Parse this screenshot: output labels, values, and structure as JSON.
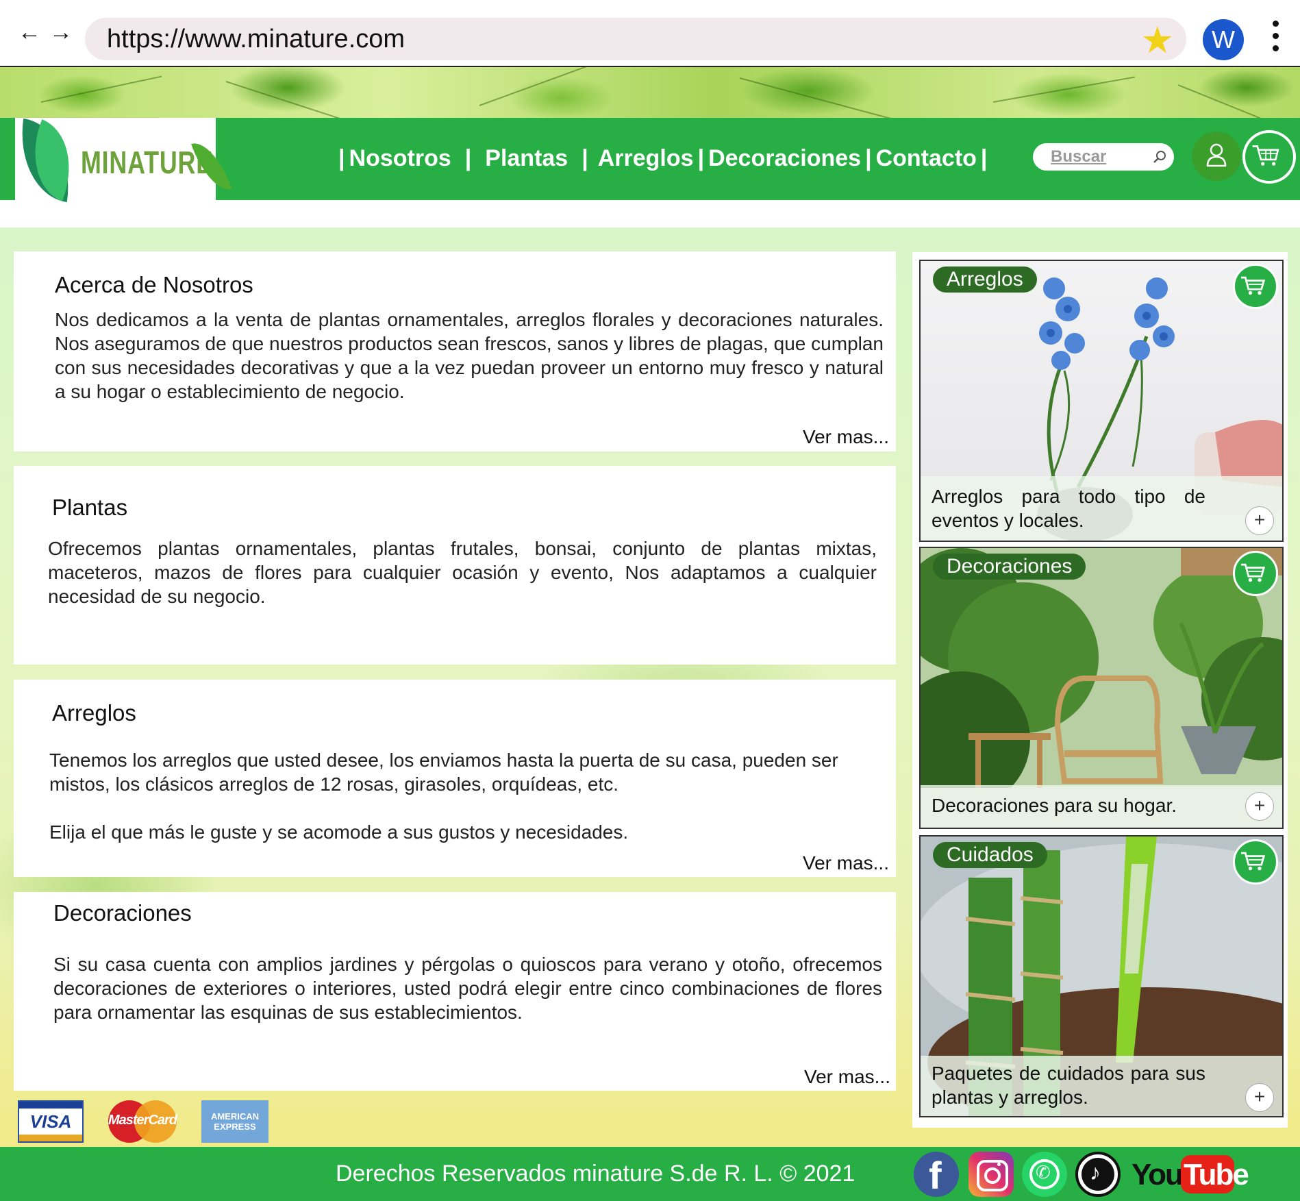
{
  "browser": {
    "url": "https://www.minature.com",
    "back_glyph": "←",
    "forward_glyph": "→",
    "profile_initial": "W"
  },
  "header": {
    "logo_text": "MINATURE",
    "nav": [
      "Nosotros",
      "Plantas",
      "Arreglos",
      "Decoraciones",
      "Contacto"
    ],
    "search_placeholder": "Buscar"
  },
  "sections": [
    {
      "title": "Acerca de Nosotros",
      "text": "Nos dedicamos a la venta de plantas ornamentales,  arreglos florales y decoraciones naturales. Nos aseguramos de que nuestros productos sean frescos, sanos y libres de plagas, que cumplan con sus necesidades decorativas y que a la vez puedan proveer un entorno muy fresco y natural a su hogar o establecimiento de negocio.",
      "more": "Ver mas..."
    },
    {
      "title": "Plantas",
      "text": "Ofrecemos plantas ornamentales, plantas frutales, bonsai, conjunto de plantas mixtas, maceteros, mazos de flores para cualquier ocasión y evento, Nos adaptamos a cualquier necesidad de su negocio."
    },
    {
      "title": "Arreglos",
      "text": "Tenemos los arreglos que usted desee, los enviamos hasta la puerta de su casa, pueden ser mistos, los clásicos arreglos de 12 rosas, girasoles, orquídeas, etc.",
      "text2": "Elija el que más le guste y se acomode a sus gustos y necesidades.",
      "more": "Ver mas..."
    },
    {
      "title": "Decoraciones",
      "text": "Si su casa cuenta con amplios jardines y pérgolas o quioscos para verano y otoño, ofrecemos decoraciones de exteriores o interiores, usted podrá elegir entre cinco combinaciones de flores para ornamentar las esquinas de sus establecimientos.",
      "more": "Ver mas..."
    }
  ],
  "products": [
    {
      "tag": "Arreglos",
      "caption": "Arreglos para todo tipo de eventos y locales.",
      "plus": "+"
    },
    {
      "tag": "Decoraciones",
      "caption": "Decoraciones para su hogar.",
      "plus": "+"
    },
    {
      "tag": "Cuidados",
      "caption": "Paquetes de cuidados para sus plantas y arreglos.",
      "plus": "+"
    }
  ],
  "payment": {
    "visa": "VISA",
    "mastercard": "MasterCard",
    "amex": "AMERICAN EXPRESS"
  },
  "footer": {
    "copyright": "Derechos Reservados minature S.de R. L. © 2021",
    "youtube_you": "You",
    "youtube_tube": "Tube"
  },
  "colors": {
    "brand_green": "#27ae45",
    "tag_green": "#2d6b24",
    "star_yellow": "#f1d218",
    "profile_blue": "#1a56cc"
  },
  "icons": [
    "back-arrow-icon",
    "forward-arrow-icon",
    "star-icon",
    "kebab-menu-icon",
    "search-icon",
    "user-icon",
    "cart-icon",
    "plus-icon",
    "facebook-icon",
    "instagram-icon",
    "whatsapp-icon",
    "tiktok-icon",
    "youtube-icon"
  ]
}
